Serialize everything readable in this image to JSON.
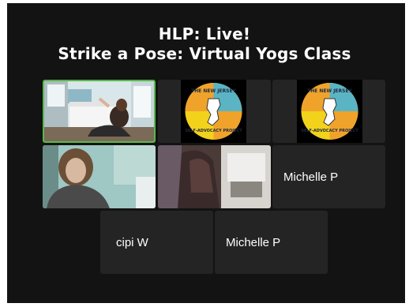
{
  "header": {
    "title_line1": "HLP: Live!",
    "title_line2": "Strike a Pose: Virtual Yogs Class"
  },
  "logo": {
    "top_text": "THE NEW JERSEY",
    "bottom_text": "SELF-ADVOCACY PROJECT"
  },
  "participants": [
    {
      "id": "p1",
      "kind": "video",
      "active": true,
      "scene": "yoga-room"
    },
    {
      "id": "p2",
      "kind": "logo"
    },
    {
      "id": "p3",
      "kind": "logo"
    },
    {
      "id": "p4",
      "kind": "video",
      "scene": "woman-teal-room"
    },
    {
      "id": "p5",
      "kind": "video",
      "scene": "hand-window"
    },
    {
      "id": "p6",
      "kind": "name",
      "name": "Michelle P"
    },
    {
      "id": "p7",
      "kind": "name",
      "name": "cipi W"
    },
    {
      "id": "p8",
      "kind": "name",
      "name": "Michelle P"
    }
  ],
  "colors": {
    "background": "#131313",
    "tile": "#242424",
    "active_border": "#59b84b",
    "logo_orange": "#f0a32a",
    "logo_teal": "#5bb4c4",
    "logo_yellow": "#f2d21b"
  }
}
